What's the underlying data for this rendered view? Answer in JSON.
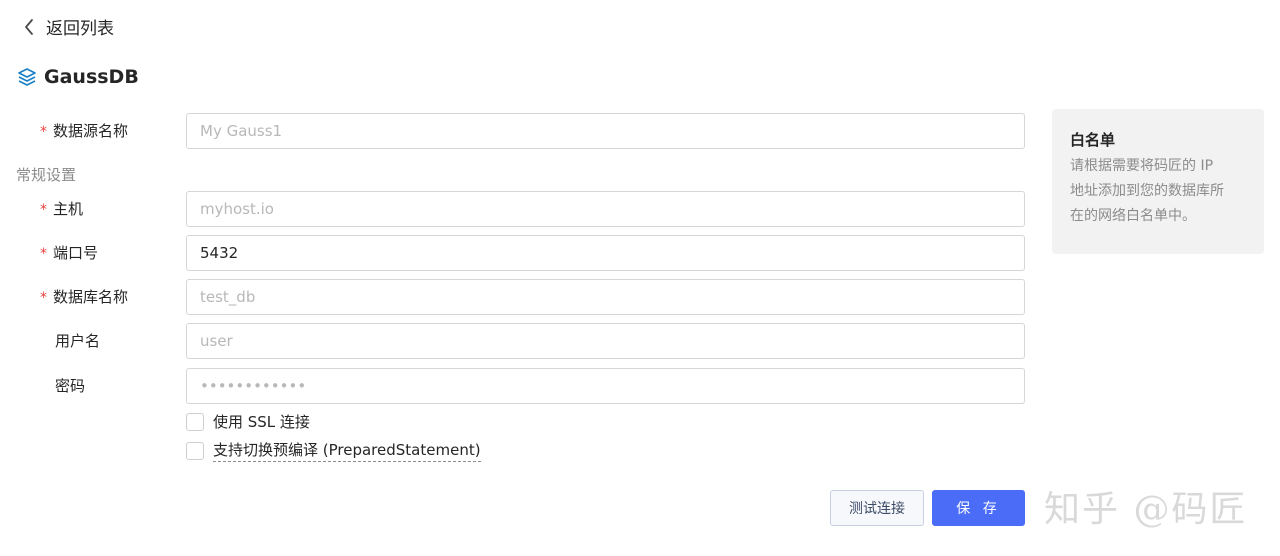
{
  "nav": {
    "back_label": "返回列表"
  },
  "datasource": {
    "name": "GaussDB"
  },
  "form": {
    "name_field": {
      "label": "数据源名称",
      "placeholder": "My Gauss1",
      "value": "",
      "required": true
    },
    "section_general": "常规设置",
    "host_field": {
      "label": "主机",
      "placeholder": "myhost.io",
      "value": "",
      "required": true
    },
    "port_field": {
      "label": "端口号",
      "placeholder": "",
      "value": "5432",
      "required": true
    },
    "database_field": {
      "label": "数据库名称",
      "placeholder": "test_db",
      "value": "",
      "required": true
    },
    "username_field": {
      "label": "用户名",
      "placeholder": "user",
      "value": "",
      "required": false
    },
    "password_field": {
      "label": "密码",
      "placeholder": "••••••••••••",
      "value": "",
      "required": false
    },
    "required_mark": "*",
    "ssl_checkbox": {
      "label": "使用 SSL 连接",
      "checked": false
    },
    "prepared_checkbox": {
      "label": "支持切换预编译 (PreparedStatement)",
      "checked": false
    }
  },
  "actions": {
    "test_label": "测试连接",
    "save_label": "保 存"
  },
  "whitelist": {
    "title": "白名单",
    "lines": [
      "请根据需要将码匠的 IP",
      "地址添加到您的数据库所",
      "在的网络白名单中。"
    ]
  },
  "watermark": "知乎 @码匠",
  "colors": {
    "primary": "#4a6cf7",
    "required": "#e8433f",
    "icon": "#1a7fc4"
  }
}
